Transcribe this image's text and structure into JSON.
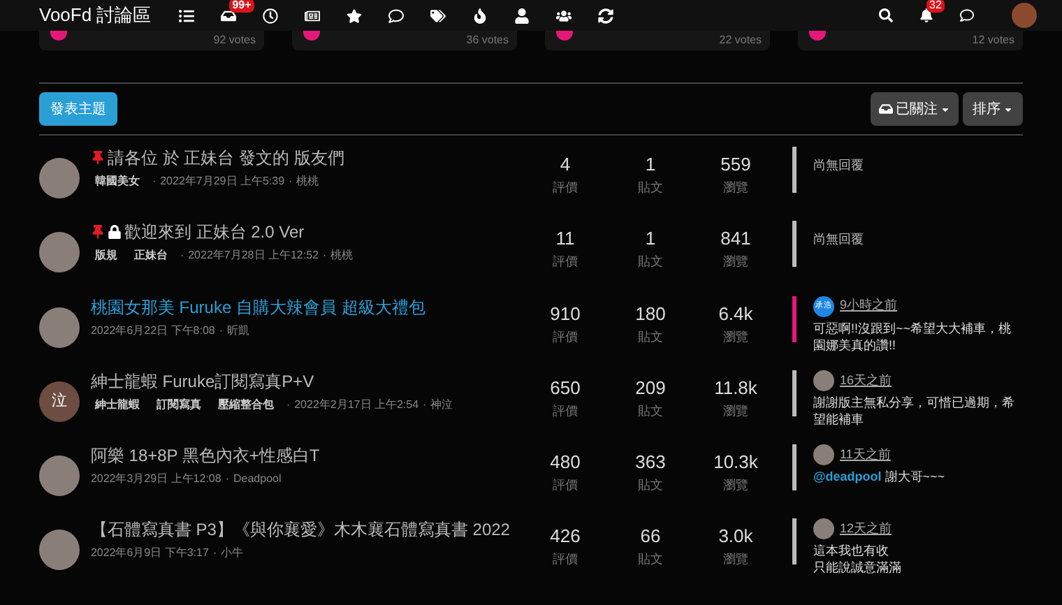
{
  "navbar": {
    "brand": "VooFd 討論區",
    "unread_badge": "99+",
    "notifications_badge": "32"
  },
  "meta_separator": "·",
  "polls": [
    {
      "votes": "92 votes"
    },
    {
      "votes": "36 votes"
    },
    {
      "votes": "22 votes"
    },
    {
      "votes": "12 votes"
    }
  ],
  "toolbar": {
    "new_topic": "發表主題",
    "watching": "已關注",
    "sort": "排序"
  },
  "topics": [
    {
      "title": "請各位 於 正妹台 發文的 版友們",
      "pinned": true,
      "unread": false,
      "avatar": {
        "kind": "photo"
      },
      "tags": [
        "韓國美女"
      ],
      "date": "2022年7月29日 上午5:39",
      "author": "桃桃",
      "votes": "4",
      "votes_label": "評價",
      "posts": "1",
      "posts_label": "貼文",
      "views": "559",
      "views_label": "瀏覽",
      "last": {
        "kind": "none",
        "text": "尚無回覆"
      }
    },
    {
      "title": "歡迎來到 正妹台 2.0 Ver",
      "pinned": true,
      "locked": true,
      "unread": false,
      "avatar": {
        "kind": "photo"
      },
      "tags": [
        "版規",
        "正妹台"
      ],
      "date": "2022年7月28日 上午12:52",
      "author": "桃桃",
      "votes": "11",
      "votes_label": "評價",
      "posts": "1",
      "posts_label": "貼文",
      "views": "841",
      "views_label": "瀏覽",
      "last": {
        "kind": "none",
        "text": "尚無回覆"
      }
    },
    {
      "title": "桃園女那美 Furuke 自購大辣會員 超級大禮包",
      "unread": true,
      "avatar": {
        "kind": "photo"
      },
      "date": "2022年6月22日 下午8:08",
      "author": "昕凱",
      "votes": "910",
      "votes_label": "評價",
      "posts": "180",
      "posts_label": "貼文",
      "views": "6.4k",
      "views_label": "瀏覽",
      "last": {
        "kind": "reply",
        "avatar": {
          "kind": "letter",
          "text": "承浩",
          "color": "#1e88e5"
        },
        "time": "9小時之前",
        "text": "可惡啊!!沒跟到~~希望大大補車，桃園娜美真的讚!!"
      }
    },
    {
      "title": "紳士龍蝦 Furuke訂閱寫真P+V",
      "unread": false,
      "avatar": {
        "kind": "letter",
        "text": "泣",
        "color": "#6d4c41"
      },
      "tags": [
        "紳士龍蝦",
        "訂閱寫真",
        "壓縮整合包"
      ],
      "date": "2022年2月17日 上午2:54",
      "author": "神泣",
      "votes": "650",
      "votes_label": "評價",
      "posts": "209",
      "posts_label": "貼文",
      "views": "11.8k",
      "views_label": "瀏覽",
      "last": {
        "kind": "reply",
        "avatar": {
          "kind": "photo"
        },
        "time": "16天之前",
        "text": "謝謝版主無私分享，可惜已過期，希望能補車"
      }
    },
    {
      "title": "阿樂 18+8P 黑色內衣+性感白T",
      "unread": false,
      "avatar": {
        "kind": "photo"
      },
      "date": "2022年3月29日 上午12:08",
      "author": "Deadpool",
      "votes": "480",
      "votes_label": "評價",
      "posts": "363",
      "posts_label": "貼文",
      "views": "10.3k",
      "views_label": "瀏覽",
      "last": {
        "kind": "mention",
        "avatar": {
          "kind": "photo"
        },
        "time": "11天之前",
        "mention": "@deadpool",
        "text": "謝大哥~~~"
      }
    },
    {
      "title": "【石體寫真書 P3】《與你襄愛》木木襄石體寫真書 2022",
      "unread": false,
      "avatar": {
        "kind": "photo"
      },
      "date": "2022年6月9日 下午3:17",
      "author": "小牛",
      "votes": "426",
      "votes_label": "評價",
      "posts": "66",
      "posts_label": "貼文",
      "views": "3.0k",
      "views_label": "瀏覽",
      "last": {
        "kind": "reply",
        "avatar": {
          "kind": "photo"
        },
        "time": "12天之前",
        "lines": [
          "這本我也有收",
          "只能說誠意滿滿"
        ]
      }
    }
  ]
}
